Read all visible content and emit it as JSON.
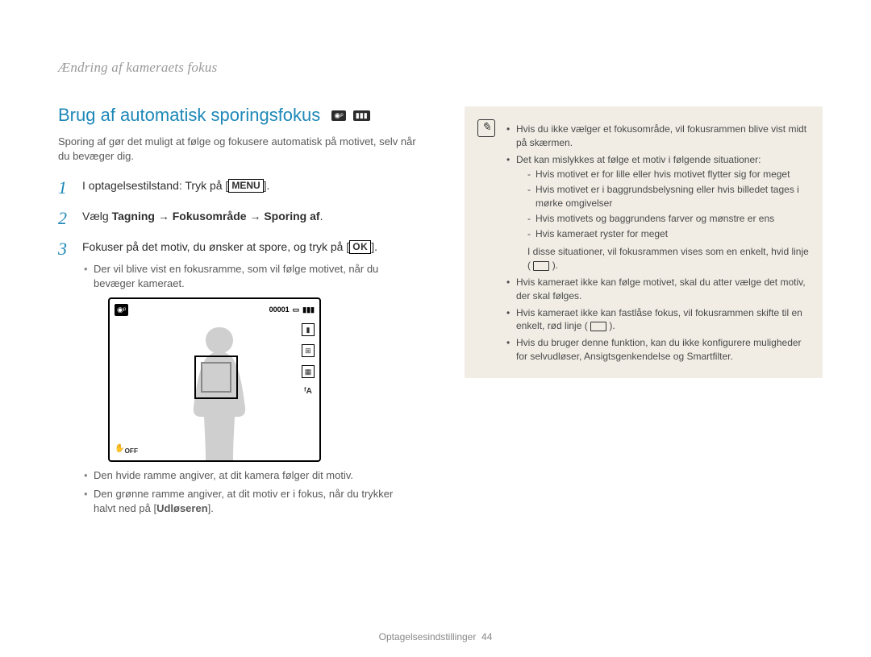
{
  "breadcrumb": "Ændring af kameraets fokus",
  "title": "Brug af automatisk sporingsfokus",
  "lede": "Sporing af gør det muligt at følge og fokusere automatisk på motivet, selv når du bevæger dig.",
  "buttons": {
    "menu": "MENU",
    "ok": "OK"
  },
  "steps": {
    "s1_a": "I optagelsestilstand: Tryk på [",
    "s1_b": "].",
    "s2_a": "Vælg ",
    "s2_b": "Tagning → Fokusområde → Sporing af",
    "s2_c": ".",
    "s3_a": "Fokuser på det motiv, du ønsker at spore, og tryk på [",
    "s3_b": "]."
  },
  "sub": {
    "b1": "Der vil blive vist en fokusramme, som vil følge motivet, når du bevæger kameraet.",
    "b2": "Den hvide ramme angiver, at dit kamera følger dit motiv.",
    "b3_a": "Den grønne ramme angiver, at dit motiv er i fokus, når du trykker halvt ned på [",
    "b3_b": "Udløseren",
    "b3_c": "]."
  },
  "figure": {
    "counter": "00001",
    "flash": "ᶠA"
  },
  "note": {
    "items": [
      "Hvis du ikke vælger et fokusområde, vil fokusrammen blive vist midt på skærmen.",
      "Det kan mislykkes at følge et motiv i følgende situationer:"
    ],
    "dash": [
      "Hvis motivet er for lille eller hvis motivet flytter sig for meget",
      "Hvis motivet er i baggrundsbelysning eller hvis billedet tages i mørke omgivelser",
      "Hvis motivets og baggrundens farver og mønstre er ens",
      "Hvis kameraet ryster for meget"
    ],
    "summary": "I disse situationer, vil fokusrammen vises som en enkelt, hvid linje (",
    "summary_b": ").",
    "tail": [
      "Hvis kameraet ikke kan følge motivet, skal du atter vælge det motiv, der skal følges.",
      "Hvis kameraet ikke kan fastlåse fokus, vil fokusrammen skifte til en enkelt, rød linje (",
      "Hvis du bruger denne funktion, kan du ikke konfigurere muligheder for selvudløser, Ansigtsgenkendelse og Smartfilter."
    ],
    "tail1_b": ")."
  },
  "footer": {
    "section": "Optagelsesindstillinger",
    "page": "44"
  }
}
